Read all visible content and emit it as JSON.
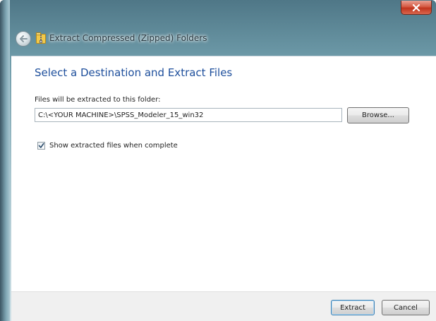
{
  "window": {
    "title": "Extract Compressed (Zipped) Folders"
  },
  "content": {
    "heading": "Select a Destination and Extract Files",
    "path_label": "Files will be extracted to this folder:",
    "path_value": "C:\\<YOUR MACHINE>\\SPSS_Modeler_15_win32",
    "browse_label": "Browse...",
    "show_files_label": "Show extracted files when complete",
    "show_files_checked": true
  },
  "footer": {
    "extract_label": "Extract",
    "cancel_label": "Cancel"
  },
  "icons": {
    "close": "close-icon",
    "back": "back-arrow-icon",
    "folder": "zip-folder-icon",
    "check": "checkmark-icon"
  },
  "colors": {
    "heading": "#1e4f9c",
    "close_button": "#c0341d",
    "default_button_border": "#3c7fb1"
  }
}
